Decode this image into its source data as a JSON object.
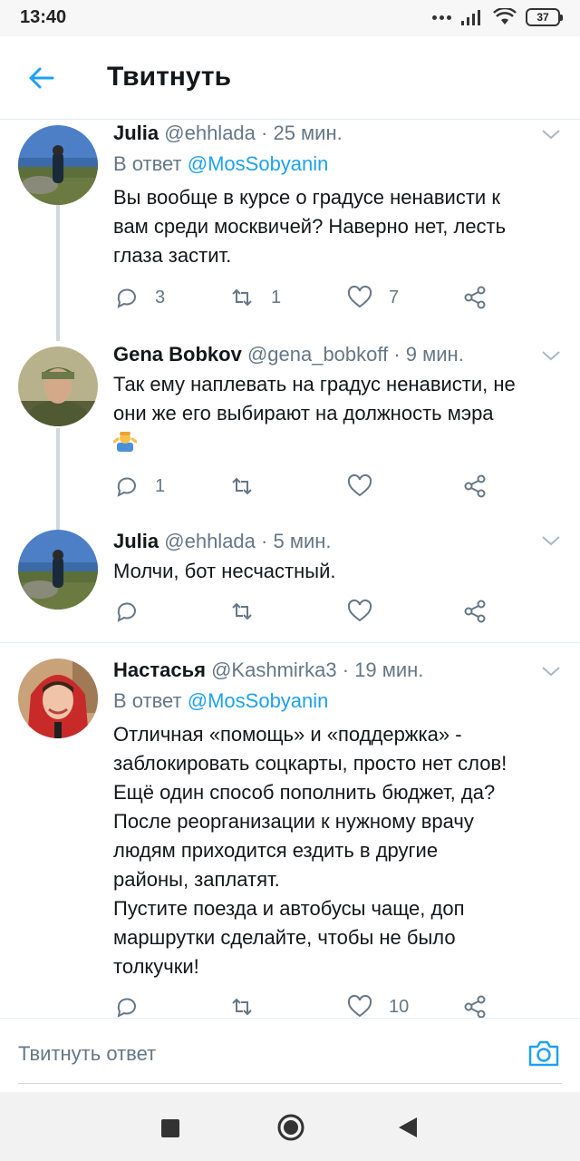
{
  "status_bar": {
    "time": "13:40",
    "battery": "37"
  },
  "header": {
    "title": "Твитнуть"
  },
  "tweets": [
    {
      "name": "Julia",
      "handle": "@ehhlada",
      "time": "· 25 мин.",
      "reply_prefix": "В ответ",
      "reply_to": "@MosSobyanin",
      "text": "Вы вообще в курсе о градусе ненависти к\nвам среди москвичей? Наверно нет, лесть\nглаза застит.",
      "replies": "3",
      "retweets": "1",
      "likes": "7"
    },
    {
      "name": "Gena Bobkov",
      "handle": "@gena_bobkoff",
      "time": "· 9 мин.",
      "text": "Так ему наплевать на градус ненависти, не\nони же его выбирают на должность мэра",
      "emoji": "person-shrugging",
      "replies": "1",
      "retweets": "",
      "likes": ""
    },
    {
      "name": "Julia",
      "handle": "@ehhlada",
      "time": "· 5 мин.",
      "text": "Молчи, бот несчастный.",
      "replies": "",
      "retweets": "",
      "likes": ""
    },
    {
      "name": "Настасья",
      "handle": "@Kashmirka3",
      "time": "· 19 мин.",
      "reply_prefix": "В ответ",
      "reply_to": "@MosSobyanin",
      "text": "Отличная «помощь» и «поддержка» -\nзаблокировать соцкарты, просто нет слов!\nЕщё один способ пополнить бюджет, да?\nПосле реорганизации к нужному врачу\nлюдям приходится ездить в другие\nрайоны, заплатят.\nПустите поезда и автобусы чаще, доп\nмаршрутки сделайте, чтобы не было\nтолкучки!",
      "replies": "",
      "retweets": "",
      "likes": "10"
    }
  ],
  "compose": {
    "placeholder": "Твитнуть ответ"
  },
  "colors": {
    "accent": "#1da1f2",
    "muted": "#657786",
    "text": "#14171a"
  }
}
